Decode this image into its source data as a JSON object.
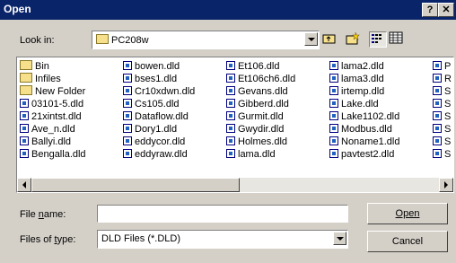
{
  "window": {
    "title": "Open",
    "help_label": "?",
    "close_label": "✕"
  },
  "look_in": {
    "label": "Look in:",
    "value": "PC208w"
  },
  "toolbar": {
    "icons": [
      "up-one-level-icon",
      "new-folder-icon",
      "list-view-icon",
      "details-view-icon"
    ]
  },
  "files": {
    "columns": [
      [
        "Bin",
        "Infiles",
        "New Folder",
        "03101-5.dld",
        "21xintst.dld",
        "Ave_n.dld",
        "Ballyi.dld",
        "Bengalla.dld"
      ],
      [
        "bowen.dld",
        "bses1.dld",
        "Cr10xdwn.dld",
        "Cs105.dld",
        "Dataflow.dld",
        "Dory1.dld",
        "eddycor.dld",
        "eddyraw.dld"
      ],
      [
        "Et106.dld",
        "Et106ch6.dld",
        "Gevans.dld",
        "Gibberd.dld",
        "Gurmit.dld",
        "Gwydir.dld",
        "Holmes.dld",
        "lama.dld"
      ],
      [
        "lama2.dld",
        "lama3.dld",
        "irtemp.dld",
        "Lake.dld",
        "Lake1102.dld",
        "Modbus.dld",
        "Noname1.dld",
        "pavtest2.dld"
      ],
      [
        "P",
        "R",
        "S",
        "S",
        "S",
        "S",
        "S",
        "S"
      ]
    ],
    "folder_count": 3
  },
  "file_name": {
    "label": "File name:",
    "value": ""
  },
  "files_of_type": {
    "label": "Files of type:",
    "value": "DLD Files (*.DLD)"
  },
  "buttons": {
    "open": "Open",
    "cancel": "Cancel"
  }
}
